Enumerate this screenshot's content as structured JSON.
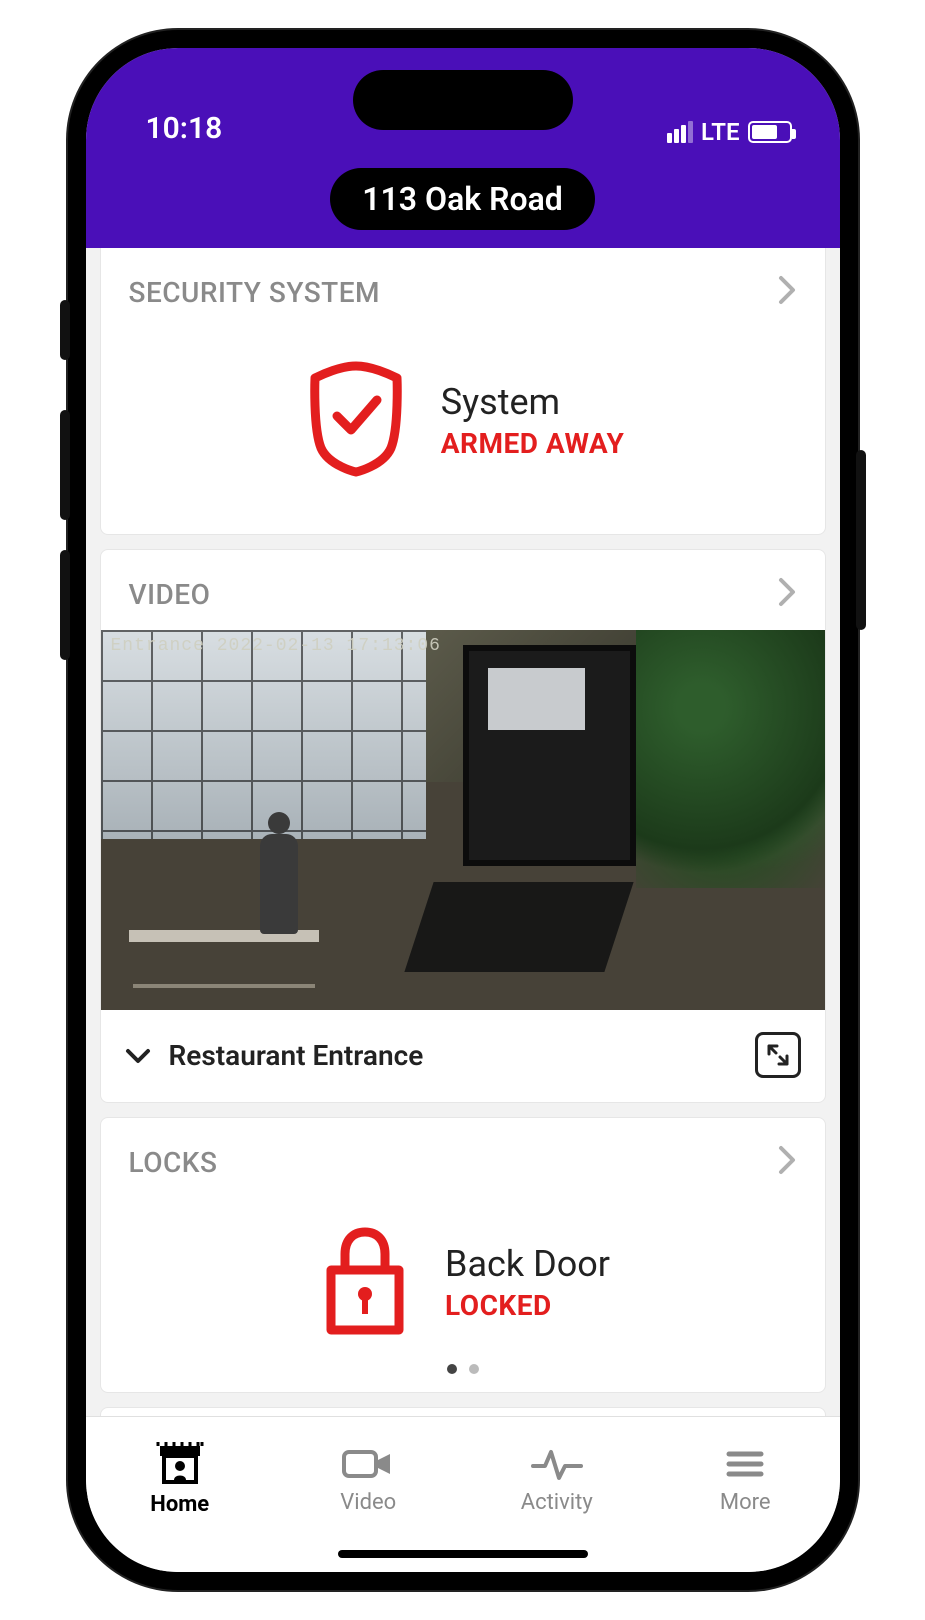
{
  "status_bar": {
    "time": "10:18",
    "network": "LTE"
  },
  "header": {
    "location": "113 Oak Road"
  },
  "cards": {
    "security": {
      "title": "SECURITY SYSTEM",
      "label": "System",
      "status": "ARMED AWAY",
      "status_color": "#e31e1e"
    },
    "video": {
      "title": "VIDEO",
      "camera_label": "Restaurant Entrance",
      "overlay_timestamp": "Entrance 2022-02-13 17:13:06"
    },
    "locks": {
      "title": "LOCKS",
      "label": "Back Door",
      "status": "LOCKED",
      "status_color": "#e31e1e",
      "page_index": 0,
      "page_count": 2
    }
  },
  "nav": {
    "items": [
      {
        "label": "Home",
        "icon": "home",
        "active": true
      },
      {
        "label": "Video",
        "icon": "video",
        "active": false
      },
      {
        "label": "Activity",
        "icon": "activity",
        "active": false
      },
      {
        "label": "More",
        "icon": "more",
        "active": false
      }
    ]
  }
}
